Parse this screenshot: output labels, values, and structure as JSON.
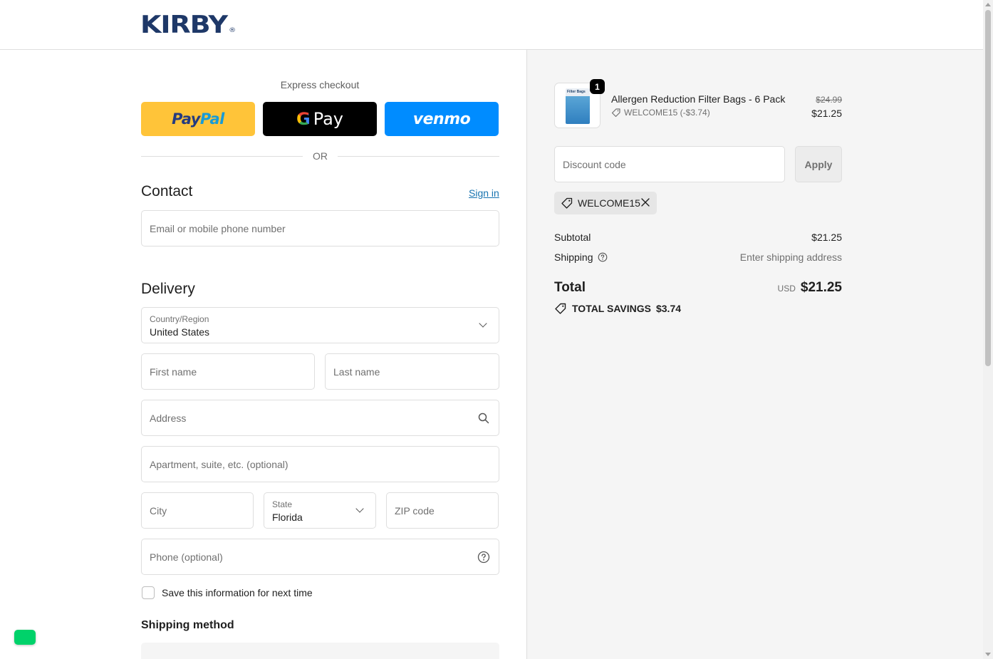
{
  "brand": {
    "name": "KIRBY",
    "mark": "®"
  },
  "express": {
    "label": "Express checkout",
    "paypal_pay": "Pay",
    "paypal_pal": "Pal",
    "gpay_label": "Pay",
    "venmo_label": "venmo",
    "or_text": "OR"
  },
  "contact": {
    "title": "Contact",
    "sign_in": "Sign in",
    "email_placeholder": "Email or mobile phone number"
  },
  "delivery": {
    "title": "Delivery",
    "country_label": "Country/Region",
    "country_value": "United States",
    "first_name": "First name",
    "last_name": "Last name",
    "address": "Address",
    "apartment": "Apartment, suite, etc. (optional)",
    "city": "City",
    "state_label": "State",
    "state_value": "Florida",
    "zip": "ZIP code",
    "phone": "Phone (optional)",
    "save_info": "Save this information for next time",
    "shipping_method": "Shipping method"
  },
  "order": {
    "item": {
      "quantity": "1",
      "name": "Allergen Reduction Filter Bags - 6 Pack",
      "discount": "WELCOME15 (-$3.74)",
      "original_price": "$24.99",
      "price": "$21.25",
      "thumb_text": "Filter Bags"
    },
    "discount_placeholder": "Discount code",
    "apply_label": "Apply",
    "applied_code": "WELCOME15",
    "subtotal_label": "Subtotal",
    "subtotal_value": "$21.25",
    "shipping_label": "Shipping",
    "shipping_value": "Enter shipping address",
    "total_label": "Total",
    "currency": "USD",
    "total_value": "$21.25",
    "savings_label": "TOTAL SAVINGS",
    "savings_value": "$3.74"
  },
  "colors": {
    "brand": "#1e3868",
    "paypal_bg": "#ffc439",
    "gpay_bg": "#000000",
    "venmo_bg": "#008cff",
    "link": "#1773b0",
    "chat": "#00d26a"
  }
}
